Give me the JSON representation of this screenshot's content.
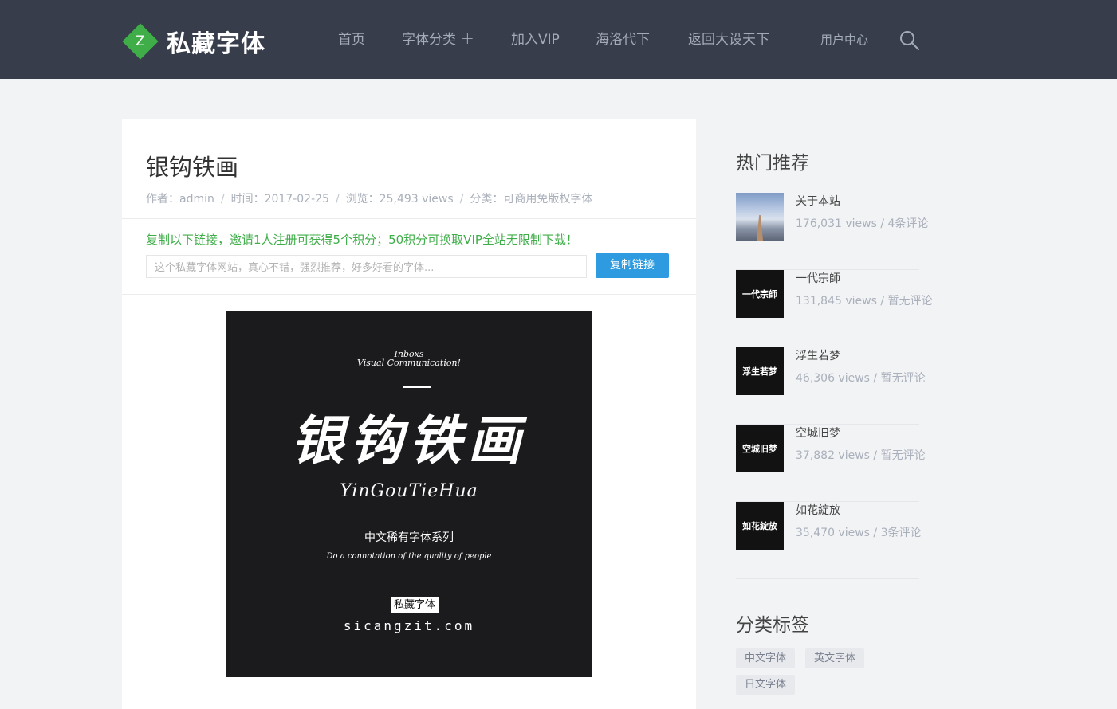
{
  "header": {
    "logo_letter": "Z",
    "site_name": "私藏字体",
    "nav": [
      {
        "label": "首页"
      },
      {
        "label": "字体分类",
        "plus": "+"
      },
      {
        "label": "加入VIP"
      },
      {
        "label": "海洛代下"
      },
      {
        "label": "返回大设天下"
      },
      {
        "label": "用户中心"
      }
    ],
    "search_icon": "search-icon"
  },
  "article": {
    "title": "银钩铁画",
    "meta": {
      "author": "作者：admin",
      "date": "时间：2017-02-25",
      "views": "浏览：25,493 views",
      "category": "分类：可商用免版权字体"
    },
    "promo": "复制以下链接，邀请1人注册可获得5个积分；50积分可换取VIP全站无限制下载！",
    "share_text": "这个私藏字体网站，真心不错，强烈推荐，好多好看的字体...",
    "copy_button": "复制链接",
    "poster": {
      "brand_line1": "Inboxs",
      "brand_line2": "Visual Communication!",
      "big_title": "银钩铁画",
      "pinyin": "YinGouTieHua",
      "series": "中文稀有字体系列",
      "tagline": "Do a connotation of the quality of people",
      "stamp": "私藏字体",
      "url": "sicangzit.com"
    }
  },
  "sidebar": {
    "hot_title": "热门推荐",
    "hot": [
      {
        "name": "关于本站",
        "stats": "176,031 views / 4条评论",
        "thumb": "sky",
        "thumb_text": ""
      },
      {
        "name": "一代宗師",
        "stats": "131,845 views / 暂无评论",
        "thumb": "dark",
        "thumb_text": "一代宗師"
      },
      {
        "name": "浮生若梦",
        "stats": "46,306 views / 暂无评论",
        "thumb": "dark",
        "thumb_text": "浮生若梦"
      },
      {
        "name": "空城旧梦",
        "stats": "37,882 views / 暂无评论",
        "thumb": "dark",
        "thumb_text": "空城旧梦"
      },
      {
        "name": "如花綻放",
        "stats": "35,470 views / 3条评论",
        "thumb": "dark",
        "thumb_text": "如花綻放"
      }
    ],
    "tags_title": "分类标签",
    "tags": [
      "中文字体",
      "英文字体",
      "日文字体"
    ]
  },
  "colors": {
    "header_bg": "#373d4b",
    "accent_green": "#3fae49",
    "button_blue": "#2e9be0"
  }
}
